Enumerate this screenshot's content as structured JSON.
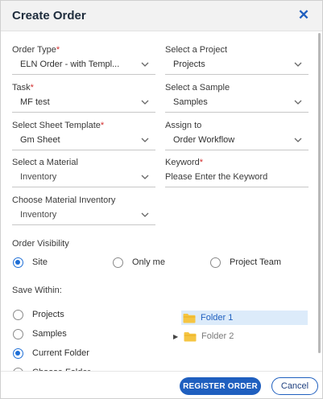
{
  "dialog": {
    "title": "Create Order",
    "close_glyph": "✕"
  },
  "fields": {
    "order_type": {
      "label": "Order Type",
      "required": "*",
      "value": "ELN Order - with Templ..."
    },
    "project": {
      "label": "Select a Project",
      "value": "Projects"
    },
    "task": {
      "label": "Task",
      "required": "*",
      "value": "MF test"
    },
    "sample": {
      "label": "Select a Sample",
      "value": "Samples"
    },
    "sheet_template": {
      "label": "Select Sheet Template",
      "required": "*",
      "value": "Gm Sheet"
    },
    "assign_to": {
      "label": "Assign to",
      "value": "Order Workflow"
    },
    "material": {
      "label": "Select a Material",
      "value": "Inventory"
    },
    "keyword": {
      "label": "Keyword",
      "required": "*",
      "placeholder": "Please Enter the Keyword"
    },
    "material_inventory": {
      "label": "Choose Material Inventory",
      "value": "Inventory"
    }
  },
  "order_visibility": {
    "label": "Order Visibility",
    "options": [
      {
        "label": "Site",
        "selected": true
      },
      {
        "label": "Only me",
        "selected": false
      },
      {
        "label": "Project Team",
        "selected": false
      }
    ]
  },
  "save_within": {
    "label": "Save Within:",
    "options": [
      {
        "label": "Projects",
        "selected": false
      },
      {
        "label": "Samples",
        "selected": false
      },
      {
        "label": "Current Folder",
        "selected": true
      },
      {
        "label": "Choose Folder",
        "selected": false
      }
    ]
  },
  "folder_tree": [
    {
      "name": "Folder 1",
      "selected": true,
      "expandable": false
    },
    {
      "name": "Folder 2",
      "selected": false,
      "expandable": true
    }
  ],
  "footer": {
    "register_label": "REGISTER ORDER",
    "cancel_label": "Cancel"
  },
  "colors": {
    "accent": "#1f5fbf",
    "required": "#d32f2f",
    "selected_row": "#dcebfa",
    "folder": "#f5c542"
  },
  "icons": {
    "close": "close-icon",
    "dropdown": "chevron-down-icon",
    "folder": "folder-icon",
    "expand": "caret-right-icon"
  }
}
